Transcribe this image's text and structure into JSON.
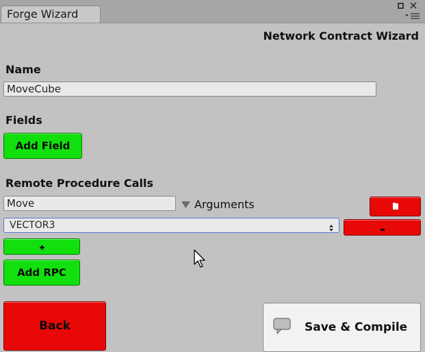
{
  "window": {
    "tab_title": "Forge Wizard",
    "icons": [
      "maximize-icon",
      "close-icon",
      "menu-icon"
    ]
  },
  "wizard": {
    "title": "Network Contract Wizard",
    "name_heading": "Name",
    "name_value": "MoveCube",
    "fields_heading": "Fields",
    "add_field_label": "Add Field",
    "rpc_heading": "Remote Procedure Calls",
    "rpc_name_value": "Move",
    "arguments_label": "Arguments",
    "argument_type": "VECTOR3",
    "add_rpc_label": "Add RPC",
    "back_label": "Back",
    "save_label": "Save & Compile"
  },
  "colors": {
    "accent_green": "#12df0e",
    "accent_red": "#e80808",
    "background": "#c2c2c2"
  }
}
